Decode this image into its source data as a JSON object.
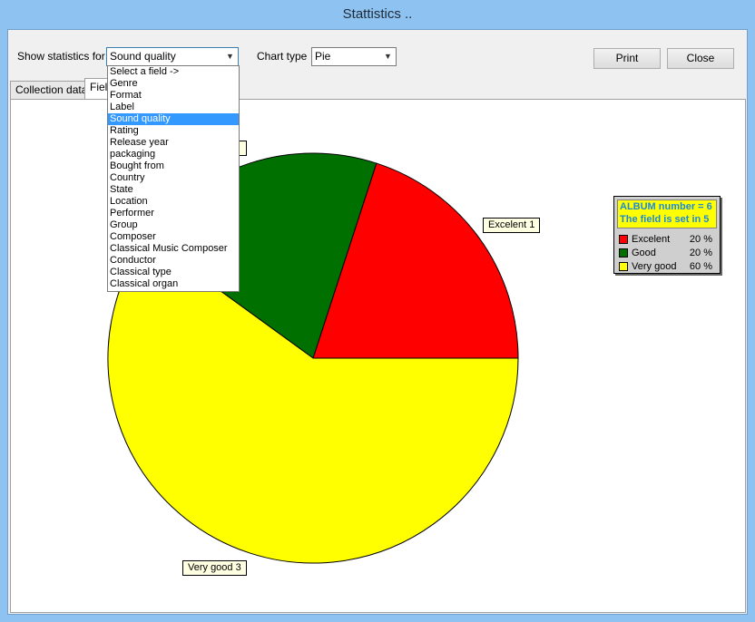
{
  "window": {
    "title": "Stattistics .."
  },
  "toolbar": {
    "show_label": "Show statistics for",
    "field_value": "Sound quality",
    "chart_type_label": "Chart type",
    "chart_type_value": "Pie",
    "print_label": "Print",
    "close_label": "Close"
  },
  "tabs": [
    "Collection data",
    "Field"
  ],
  "dropdown": {
    "items": [
      "Select a field ->",
      "Genre",
      "Format",
      "Label",
      "Sound quality",
      "Rating",
      "Release year",
      "packaging",
      "Bought from",
      "Country",
      "State",
      "Location",
      "Performer",
      "Group",
      "Composer",
      "Classical Music Composer",
      "Conductor",
      "Classical type",
      "Classical organ"
    ],
    "selected": "Sound quality"
  },
  "legend": {
    "line1": "ALBUM number = 6",
    "line2": "The field is set in 5"
  },
  "colors": {
    "excelent": "#ff0000",
    "good": "#007000",
    "very_good": "#ffff00"
  },
  "chart_data": {
    "type": "pie",
    "slices": [
      {
        "name": "Excelent",
        "count": 1,
        "percent": 20,
        "label": "Excelent 1",
        "legend_pct": "20 %"
      },
      {
        "name": "Good",
        "count": 1,
        "percent": 20,
        "label": "",
        "legend_pct": "20 %"
      },
      {
        "name": "Very good",
        "count": 3,
        "percent": 60,
        "label": "Very good 3",
        "legend_pct": "60 %"
      }
    ]
  }
}
